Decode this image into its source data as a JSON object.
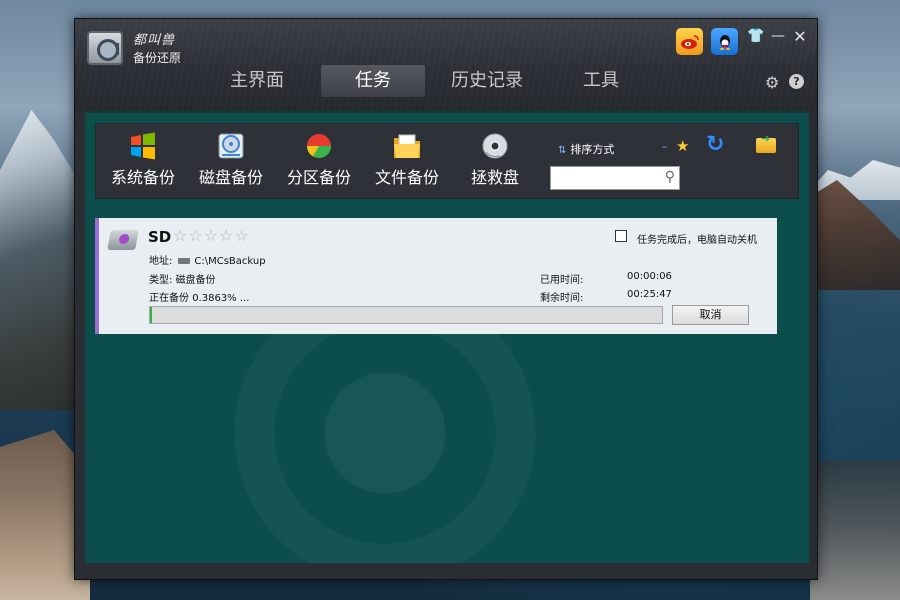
{
  "app": {
    "brand_name": "都叫兽",
    "brand_subtitle": "备份还原"
  },
  "tabs": [
    {
      "label": "主界面"
    },
    {
      "label": "任务"
    },
    {
      "label": "历史记录"
    },
    {
      "label": "工具"
    }
  ],
  "active_tab": "任务",
  "toolbar": {
    "items": [
      {
        "label": "系统备份",
        "icon": "windows-logo-icon"
      },
      {
        "label": "磁盘备份",
        "icon": "disk-icon"
      },
      {
        "label": "分区备份",
        "icon": "pie-chart-icon"
      },
      {
        "label": "文件备份",
        "icon": "folder-files-icon"
      },
      {
        "label": "拯救盘",
        "icon": "cd-icon"
      }
    ],
    "sort_label": "排序方式",
    "search_placeholder": ""
  },
  "task": {
    "name": "SD",
    "stars": "☆☆☆☆☆",
    "address_label": "地址:",
    "address": "C:\\MCsBackup",
    "type_label": "类型:",
    "type_value": "磁盘备份",
    "status_label": "正在备份",
    "status_value": "0.3863% ...",
    "elapsed_label": "已用时间:",
    "elapsed": "00:00:06",
    "remaining_label": "剩余时间:",
    "remaining": "00:25:47",
    "shutdown_label": "任务完成后，电脑自动关机",
    "shutdown_checked": false,
    "progress_percent": 0.3863,
    "cancel_label": "取消"
  },
  "colors": {
    "content_bg": "#0b4e4c",
    "progress_fill": "#2fb34a",
    "task_accent": "#9b6bd6"
  }
}
